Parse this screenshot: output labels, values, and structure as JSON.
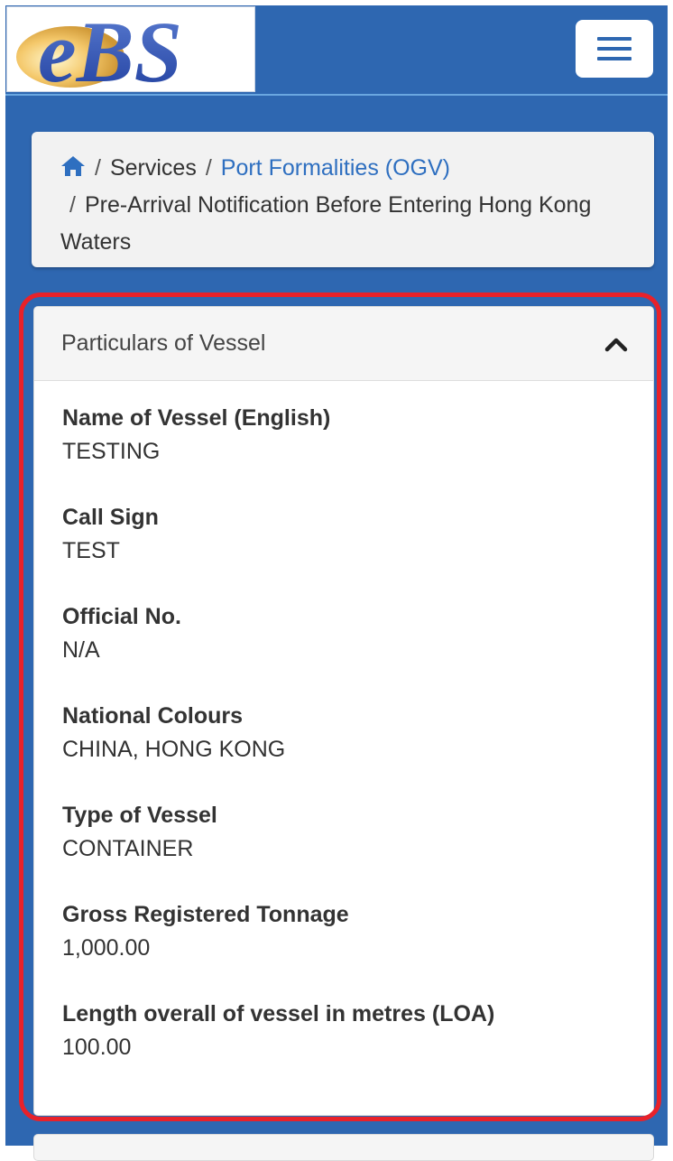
{
  "header": {
    "logo_text": "eBS",
    "menu_icon": "hamburger-menu-icon"
  },
  "breadcrumb": {
    "home_icon": "home-icon",
    "separator": "/",
    "items": [
      {
        "label": "Services"
      },
      {
        "label": "Port Formalities (OGV)"
      },
      {
        "label": "Pre-Arrival Notification Before Entering Hong Kong Waters"
      }
    ]
  },
  "panel": {
    "title": "Particulars of Vessel",
    "toggle_icon": "chevron-up-icon",
    "fields": [
      {
        "label": "Name of Vessel (English)",
        "value": "TESTING"
      },
      {
        "label": "Call Sign",
        "value": "TEST"
      },
      {
        "label": "Official No.",
        "value": "N/A"
      },
      {
        "label": "National Colours",
        "value": "CHINA, HONG KONG"
      },
      {
        "label": "Type of Vessel",
        "value": "CONTAINER"
      },
      {
        "label": "Gross Registered Tonnage",
        "value": "1,000.00"
      },
      {
        "label": "Length overall of vessel in metres (LOA)",
        "value": "100.00"
      }
    ]
  },
  "colors": {
    "navbar": "#2e67b1",
    "link": "#2e6fc0",
    "highlight": "#e8222a"
  }
}
